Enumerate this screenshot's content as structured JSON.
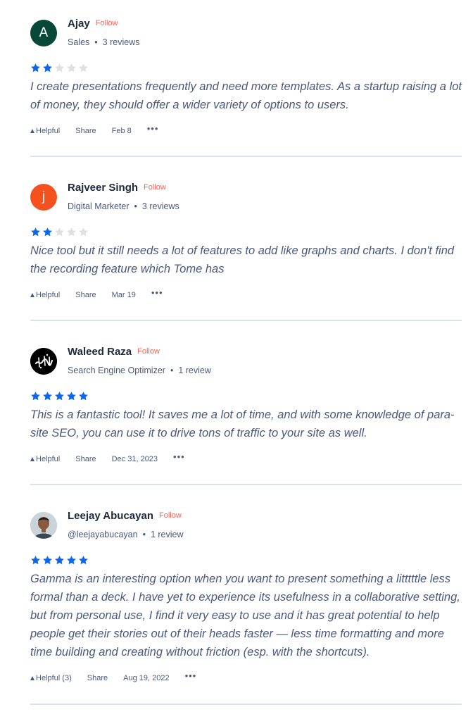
{
  "colors": {
    "star_filled": "#0a66f0",
    "star_empty": "#e0e0e0",
    "follow": "#ff6154"
  },
  "reviews": [
    {
      "avatar_initial": "A",
      "avatar_color": "#074836",
      "name": "Ajay",
      "follow_label": "Follow",
      "headline": "Sales",
      "review_count": "3 reviews",
      "rating": 2,
      "text": "I create presentations frequently and need more templates. As a startup raising a lot of money, they should offer a wider variety of options to users.",
      "helpful_label": "Helpful",
      "share_label": "Share",
      "date": "Feb 8",
      "more_label": "•••"
    },
    {
      "avatar_initial": "j",
      "avatar_color": "#f4511e",
      "name": "Rajveer Singh",
      "follow_label": "Follow",
      "headline": "Digital Marketer",
      "review_count": "3 reviews",
      "rating": 2,
      "text": "Nice tool but it still needs a lot of features to add like graphs and charts. I don't find the recording feature which Tome has",
      "helpful_label": "Helpful",
      "share_label": "Share",
      "date": "Mar 19",
      "more_label": "•••"
    },
    {
      "avatar_initial": "",
      "avatar_color": "#000000",
      "name": "Waleed Raza",
      "follow_label": "Follow",
      "headline": "Search Engine Optimizer",
      "review_count": "1 review",
      "rating": 5,
      "text": "This is a fantastic tool! It saves me a lot of time, and with some knowledge of para-site SEO, you can use it to drive tons of traffic to your site as well.",
      "helpful_label": "Helpful",
      "share_label": "Share",
      "date": "Dec 31, 2023",
      "more_label": "•••"
    },
    {
      "avatar_initial": "",
      "avatar_color": "#b7c3cc",
      "name": "Leejay Abucayan",
      "follow_label": "Follow",
      "headline": "@leejayabucayan",
      "review_count": "1 review",
      "rating": 5,
      "text": "Gamma is an interesting option when you want to present something a litttttle less formal than a deck. I have yet to experience its usefulness in a collaborative setting, but from personal use, I find it very easy to use and it has great potential to help people get their stories out of their heads faster — less time formatting and more time building and creating without friction (esp. with the shortcuts).",
      "helpful_label": "Helpful (3)",
      "share_label": "Share",
      "date": "Aug 19, 2022",
      "more_label": "•••"
    }
  ]
}
